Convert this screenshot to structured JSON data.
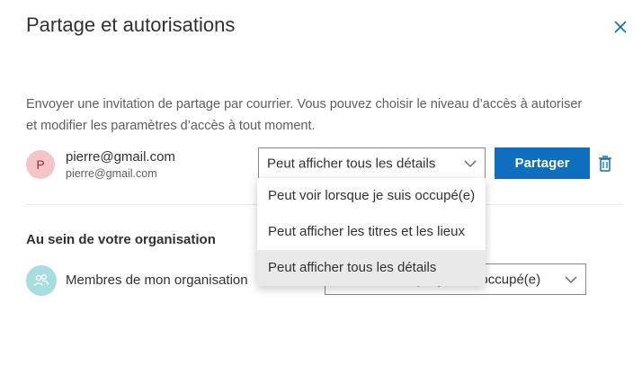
{
  "dialog": {
    "title": "Partage et autorisations",
    "description_line1": "Envoyer une invitation de partage par courrier. Vous pouvez choisir le niveau d’accès à autoriser",
    "description_line2": "et modifier les paramètres d’accès à tout moment."
  },
  "invitee": {
    "avatar_initial": "P",
    "name": "pierre@gmail.com",
    "email": "pierre@gmail.com",
    "permission_value": "Peut afficher tous les détails",
    "share_label": "Partager"
  },
  "permission_options": [
    "Peut voir lorsque je suis occupé(e)",
    "Peut afficher les titres et les lieux",
    "Peut afficher tous les détails"
  ],
  "organization": {
    "heading": "Au sein de votre organisation",
    "members_label": "Membres de mon organisation",
    "permission_value": "Peut voir lorsque je suis occupé(e)"
  },
  "colors": {
    "accent": "#106ebe",
    "avatar_bg": "#f4c5c8",
    "org_avatar_bg": "#a6dde0"
  },
  "icons": {
    "close": "close-icon",
    "trash": "trash-icon",
    "chevron": "chevron-down-icon",
    "group": "people-icon"
  }
}
